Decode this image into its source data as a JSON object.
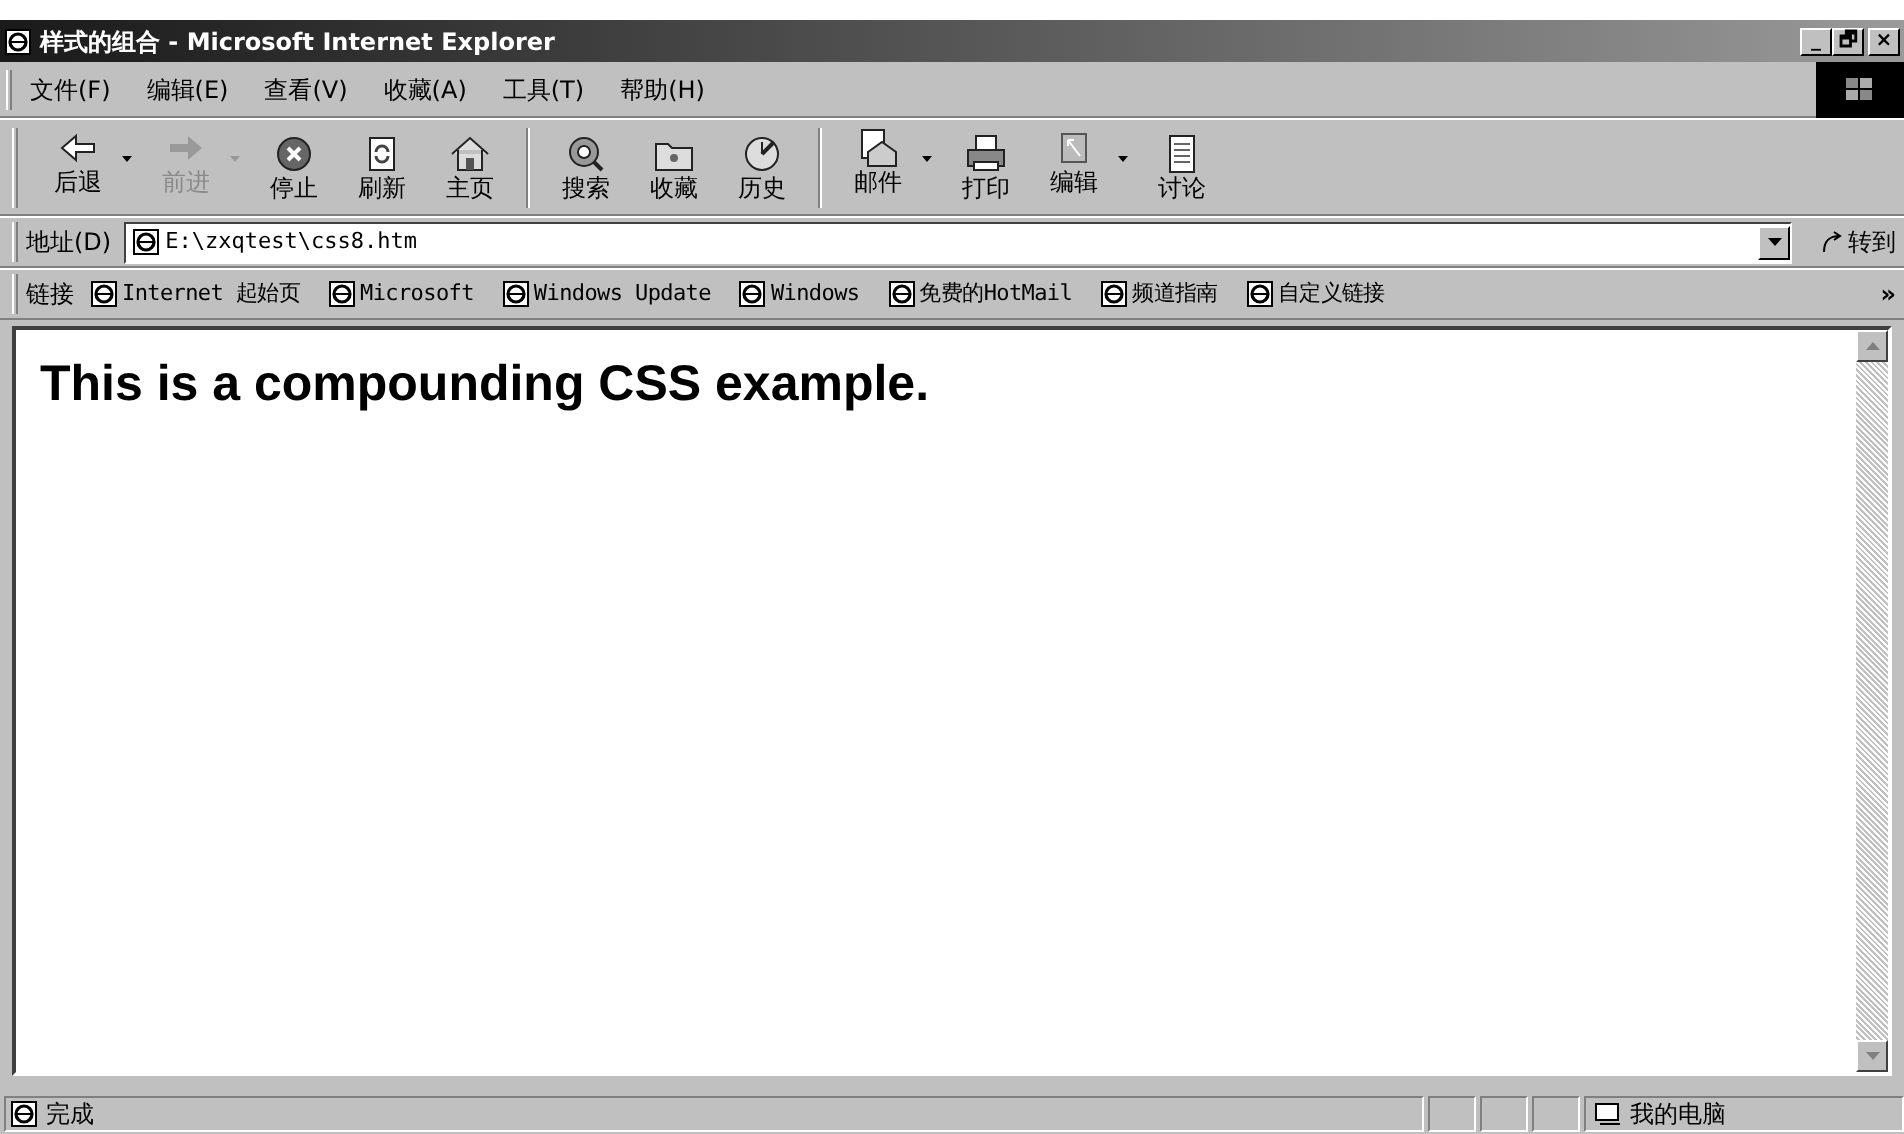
{
  "window": {
    "title": "样式的组合 - Microsoft Internet Explorer",
    "controls": [
      "_",
      "🗗",
      "×"
    ]
  },
  "menu": [
    "文件(F)",
    "编辑(E)",
    "查看(V)",
    "收藏(A)",
    "工具(T)",
    "帮助(H)"
  ],
  "toolbar": [
    {
      "label": "后退",
      "kind": "back",
      "disabled": false,
      "dropdown": true
    },
    {
      "label": "前进",
      "kind": "forward",
      "disabled": true,
      "dropdown": true
    },
    {
      "label": "停止",
      "kind": "stop",
      "disabled": false,
      "dropdown": false
    },
    {
      "label": "刷新",
      "kind": "refresh",
      "disabled": false,
      "dropdown": false
    },
    {
      "label": "主页",
      "kind": "home",
      "disabled": false,
      "dropdown": false
    },
    {
      "kind": "separator"
    },
    {
      "label": "搜索",
      "kind": "search",
      "disabled": false,
      "dropdown": false
    },
    {
      "label": "收藏",
      "kind": "favorites",
      "disabled": false,
      "dropdown": false
    },
    {
      "label": "历史",
      "kind": "history",
      "disabled": false,
      "dropdown": false
    },
    {
      "kind": "separator"
    },
    {
      "label": "邮件",
      "kind": "mail",
      "disabled": false,
      "dropdown": true
    },
    {
      "label": "打印",
      "kind": "print",
      "disabled": false,
      "dropdown": false
    },
    {
      "label": "编辑",
      "kind": "edit",
      "disabled": false,
      "dropdown": true
    },
    {
      "label": "讨论",
      "kind": "discuss",
      "disabled": false,
      "dropdown": false
    }
  ],
  "address": {
    "label": "地址(D)",
    "value": "E:\\zxqtest\\css8.htm",
    "go": "转到"
  },
  "links": {
    "label": "链接",
    "items": [
      "Internet 起始页",
      "Microsoft",
      "Windows Update",
      "Windows",
      "免费的HotMail",
      "频道指南",
      "自定义链接"
    ],
    "more": "»"
  },
  "page": {
    "heading": "This is a compounding CSS example."
  },
  "status_bar": {
    "text": "完成",
    "zone": "我的电脑"
  }
}
